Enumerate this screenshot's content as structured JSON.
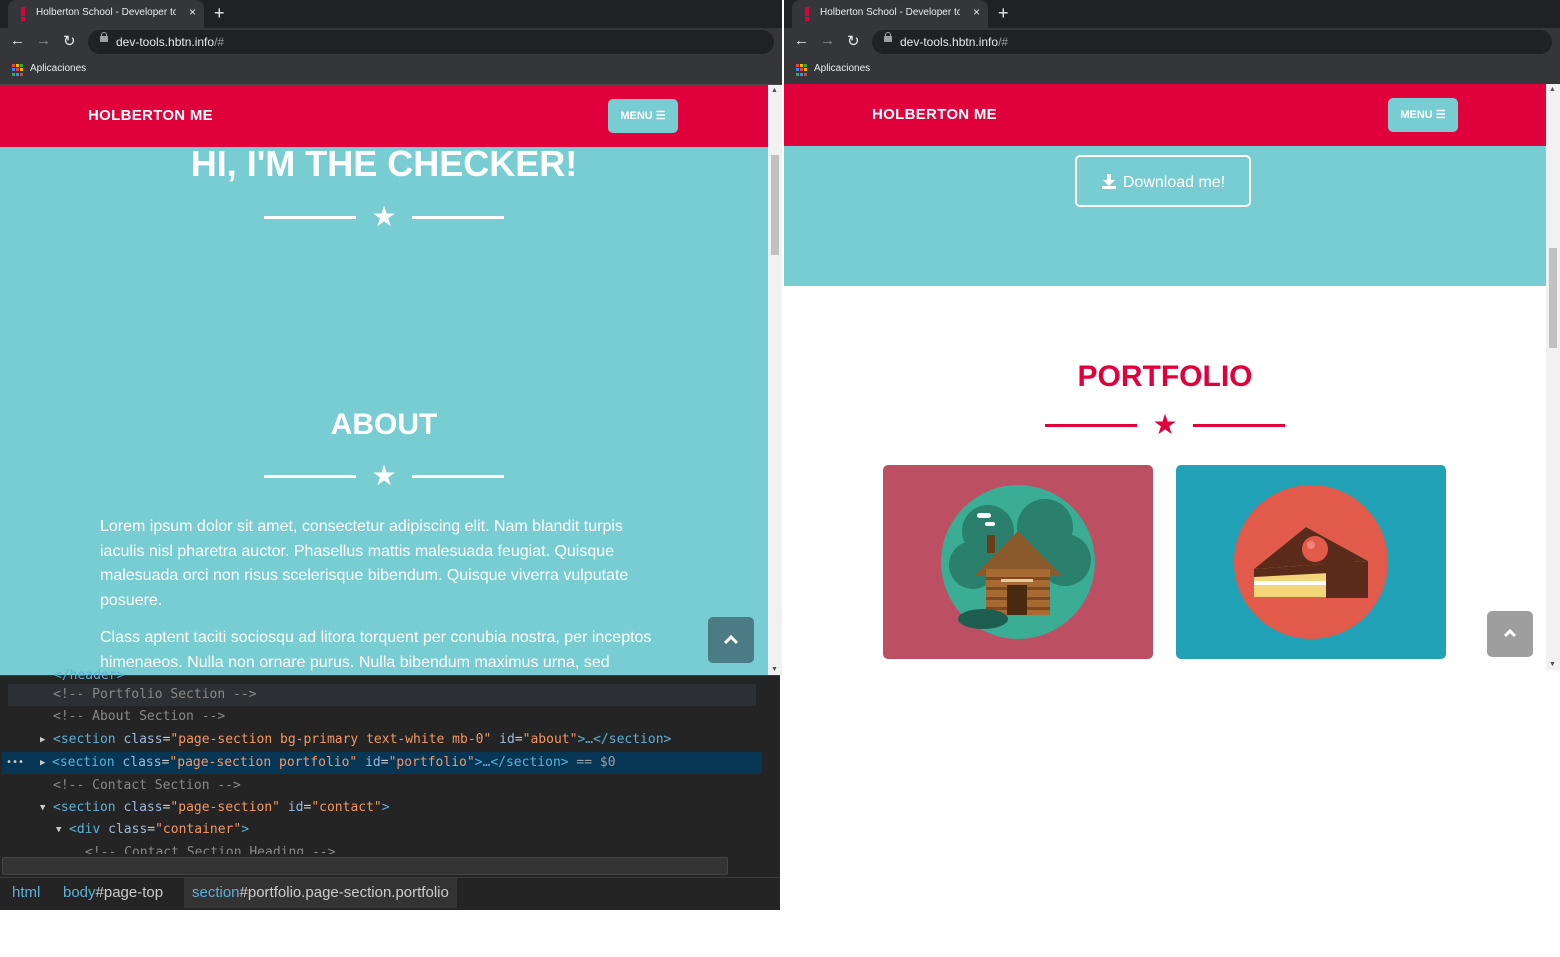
{
  "browser": {
    "tab_title": "Holberton School - Developer to",
    "tab_close": "×",
    "new_tab": "+",
    "url_host": "dev-tools.hbtn.info",
    "url_rest": "/#",
    "bookmark_apps": "Aplicaciones"
  },
  "site": {
    "brand": "HOLBERTON ME",
    "menu_label": "MENU ☰",
    "colors": {
      "primary": "#e0003c",
      "teal": "#78cdd2",
      "card_pink": "#bd4f63",
      "card_blue": "#21a2b6"
    }
  },
  "left": {
    "hero_heading": "HI, I'M THE CHECKER!",
    "about_heading": "ABOUT",
    "about_p1": "Lorem ipsum dolor sit amet, consectetur adipiscing elit. Nam blandit turpis iaculis nisl pharetra auctor. Phasellus mattis malesuada feugiat. Quisque malesuada orci non risus scelerisque bibendum. Quisque viverra vulputate posuere.",
    "about_p2": "Class aptent taciti sociosqu ad litora torquent per conubia nostra, per inceptos himenaeos. Nulla non ornare purus. Nulla bibendum maximus urna, sed finibus"
  },
  "right": {
    "download_label": "Download me!",
    "portfolio_heading": "PORTFOLIO",
    "card_left_icon": "cabin-icon",
    "card_right_icon": "cake-slice-icon"
  },
  "devtools": {
    "clipped_top": "</header>",
    "line_portfolio_comment": "<!-- Portfolio Section -->",
    "line_about_comment": "<!-- About Section -->",
    "about_section": {
      "tag": "section",
      "class_attr": "class",
      "class_val": "\"page-section bg-primary text-white mb-0\"",
      "id_attr": "id",
      "id_val": "\"about\"",
      "tail": ">…</section>"
    },
    "portfolio_section": {
      "tag": "section",
      "class_attr": "class",
      "class_val": "\"page-section portfolio\"",
      "id_attr": "id",
      "id_val": "\"portfolio\"",
      "tail": ">…</section>",
      "marker": "== $0",
      "dots": "•••"
    },
    "line_contact_comment": "<!-- Contact Section -->",
    "contact_section": {
      "tag": "section",
      "class_attr": "class",
      "class_val": "\"page-section\"",
      "id_attr": "id",
      "id_val": "\"contact\"",
      "tail": ">"
    },
    "container_div": {
      "tag": "div",
      "class_attr": "class",
      "class_val": "\"container\"",
      "tail": ">"
    },
    "clipped_bottom": "<!-- Contact Section Heading -->",
    "breadcrumbs": [
      {
        "tag": "html",
        "tail": ""
      },
      {
        "tag": "body",
        "tail": "#page-top"
      },
      {
        "tag": "section",
        "tail": "#portfolio.page-section.portfolio"
      }
    ]
  }
}
